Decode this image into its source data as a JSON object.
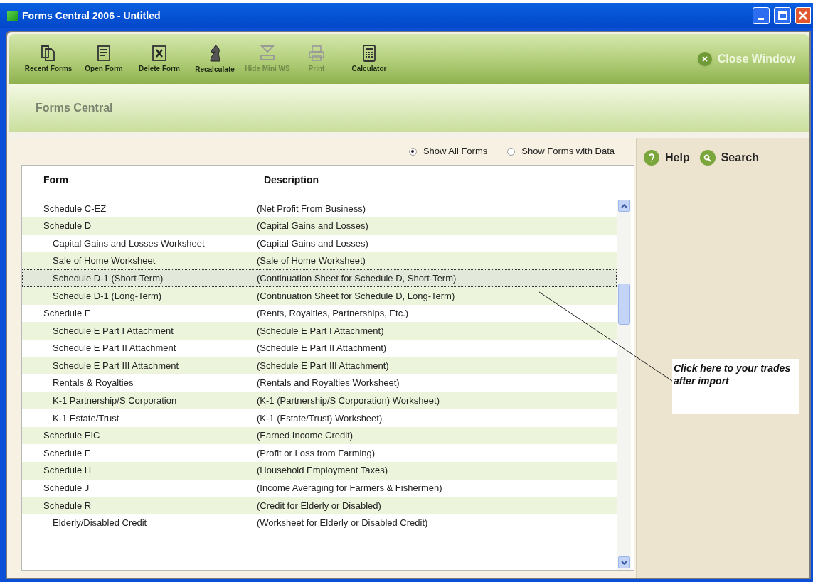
{
  "window": {
    "title": "Forms Central 2006 - Untitled"
  },
  "toolbar": [
    {
      "label": "Recent Forms",
      "disabled": false
    },
    {
      "label": "Open Form",
      "disabled": false
    },
    {
      "label": "Delete Form",
      "disabled": false
    },
    {
      "label": "Recalculate",
      "disabled": false
    },
    {
      "label": "Hide Mini WS",
      "disabled": true
    },
    {
      "label": "Print",
      "disabled": true
    },
    {
      "label": "Calculator",
      "disabled": false
    }
  ],
  "close_button": {
    "label": "Close Window"
  },
  "header": {
    "title": "Forms Central"
  },
  "filter": [
    {
      "label": "Show All Forms",
      "selected": true
    },
    {
      "label": "Show Forms with Data",
      "selected": false
    }
  ],
  "side_links": [
    {
      "label": "Help"
    },
    {
      "label": "Search"
    }
  ],
  "table": {
    "columns": [
      "Form",
      "Description"
    ],
    "rows": [
      {
        "form": "Schedule C-EZ",
        "description": "(Net Profit From Business)",
        "selected": false
      },
      {
        "form": "Schedule D",
        "description": "(Capital Gains and Losses)",
        "selected": false,
        "children": [
          {
            "form": "Capital Gains and Losses Worksheet",
            "description": "(Capital Gains and Losses)",
            "selected": false
          },
          {
            "form": "Sale of Home Worksheet",
            "description": "(Sale of Home Worksheet)",
            "selected": false
          },
          {
            "form": "Schedule D-1 (Short-Term)",
            "description": "(Continuation Sheet for Schedule D, Short-Term)",
            "selected": true
          },
          {
            "form": "Schedule D-1 (Long-Term)",
            "description": "(Continuation Sheet for Schedule D, Long-Term)",
            "selected": false
          }
        ]
      },
      {
        "form": "Schedule E",
        "description": "(Rents, Royalties, Partnerships, Etc.)",
        "selected": false,
        "children": [
          {
            "form": "Schedule E Part I Attachment",
            "description": "(Schedule E Part I Attachment)",
            "selected": false
          },
          {
            "form": "Schedule E Part II Attachment",
            "description": "(Schedule E Part II Attachment)",
            "selected": false
          },
          {
            "form": "Schedule E Part III Attachment",
            "description": "(Schedule E Part III Attachment)",
            "selected": false
          },
          {
            "form": "Rentals & Royalties",
            "description": "(Rentals and Royalties Worksheet)",
            "selected": false
          },
          {
            "form": "K-1 Partnership/S Corporation",
            "description": "(K-1 (Partnership/S Corporation) Worksheet)",
            "selected": false
          },
          {
            "form": "K-1 Estate/Trust",
            "description": "(K-1 (Estate/Trust) Worksheet)",
            "selected": false
          }
        ]
      },
      {
        "form": "Schedule EIC",
        "description": "(Earned Income Credit)",
        "selected": false
      },
      {
        "form": "Schedule F",
        "description": "(Profit or Loss from Farming)",
        "selected": false
      },
      {
        "form": "Schedule H",
        "description": "(Household Employment Taxes)",
        "selected": false
      },
      {
        "form": "Schedule J",
        "description": "(Income Averaging for Farmers & Fishermen)",
        "selected": false
      },
      {
        "form": "Schedule R",
        "description": "(Credit for Elderly or Disabled)",
        "selected": false,
        "children": [
          {
            "form": "Elderly/Disabled Credit",
            "description": "(Worksheet for Elderly or Disabled Credit)",
            "selected": false
          }
        ]
      }
    ]
  },
  "callout": {
    "text": "Click here to your trades after import"
  }
}
